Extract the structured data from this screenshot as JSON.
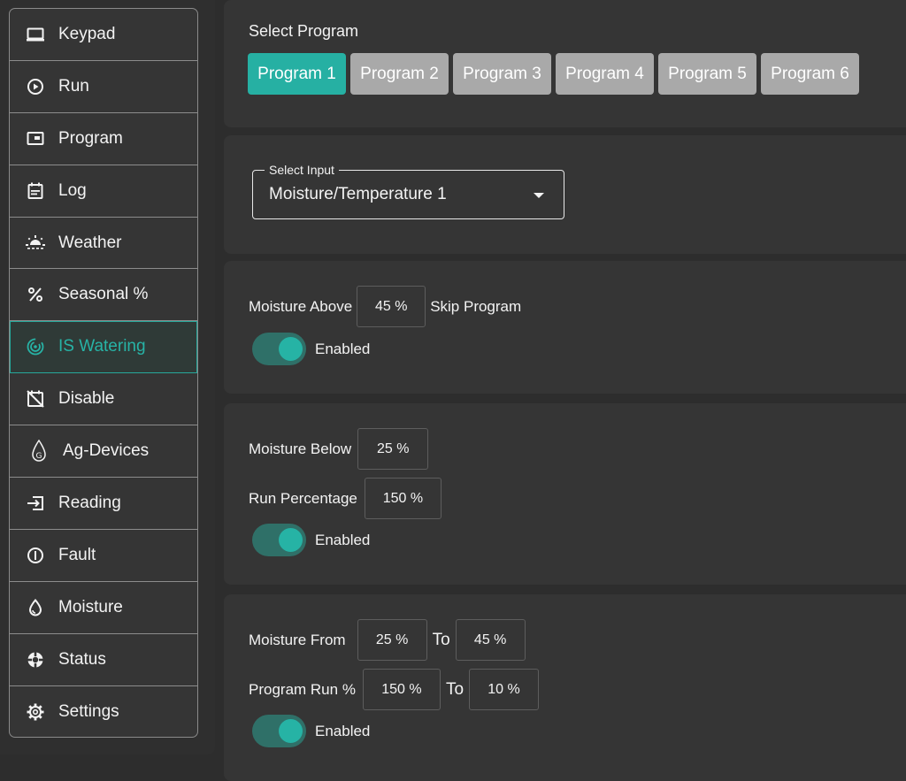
{
  "sidebar": {
    "items": [
      {
        "label": "Keypad",
        "icon": "keypad-icon"
      },
      {
        "label": "Run",
        "icon": "play-circle-icon"
      },
      {
        "label": "Program",
        "icon": "program-icon"
      },
      {
        "label": "Log",
        "icon": "log-icon"
      },
      {
        "label": "Weather",
        "icon": "sun-icon"
      },
      {
        "label": "Seasonal %",
        "icon": "percent-icon"
      },
      {
        "label": "IS Watering",
        "icon": "watering-icon"
      },
      {
        "label": "Disable",
        "icon": "disable-icon"
      },
      {
        "label": "Ag-Devices",
        "icon": "ag-devices-icon"
      },
      {
        "label": "Reading",
        "icon": "reading-icon"
      },
      {
        "label": "Fault",
        "icon": "fault-icon"
      },
      {
        "label": "Moisture",
        "icon": "droplet-icon"
      },
      {
        "label": "Status",
        "icon": "status-icon"
      },
      {
        "label": "Settings",
        "icon": "gear-icon"
      }
    ],
    "active": "IS Watering"
  },
  "program_select": {
    "title": "Select Program",
    "tabs": [
      "Program 1",
      "Program 2",
      "Program 3",
      "Program 4",
      "Program 5",
      "Program 6"
    ],
    "selected": "Program 1"
  },
  "input_select": {
    "legend": "Select Input",
    "value": "Moisture/Temperature 1"
  },
  "skip_section": {
    "label": "Moisture Above",
    "value": "45 %",
    "suffix": "Skip Program",
    "toggle_label": "Enabled",
    "enabled": true
  },
  "below_section": {
    "below_label": "Moisture Below",
    "below_value": "25 %",
    "run_label": "Run Percentage",
    "run_value": "150 %",
    "toggle_label": "Enabled",
    "enabled": true
  },
  "range_section": {
    "from_label": "Moisture From",
    "from_value": "25 %",
    "to_label_1": "To",
    "to_value_1": "45 %",
    "run_label": "Program Run %",
    "run_from_value": "150 %",
    "to_label_2": "To",
    "run_to_value": "10 %",
    "toggle_label": "Enabled",
    "enabled": true
  },
  "colors": {
    "accent": "#26b0a3",
    "background": "#2d2d2d",
    "card": "#353535",
    "inactive_tab": "#a9a9a9"
  }
}
